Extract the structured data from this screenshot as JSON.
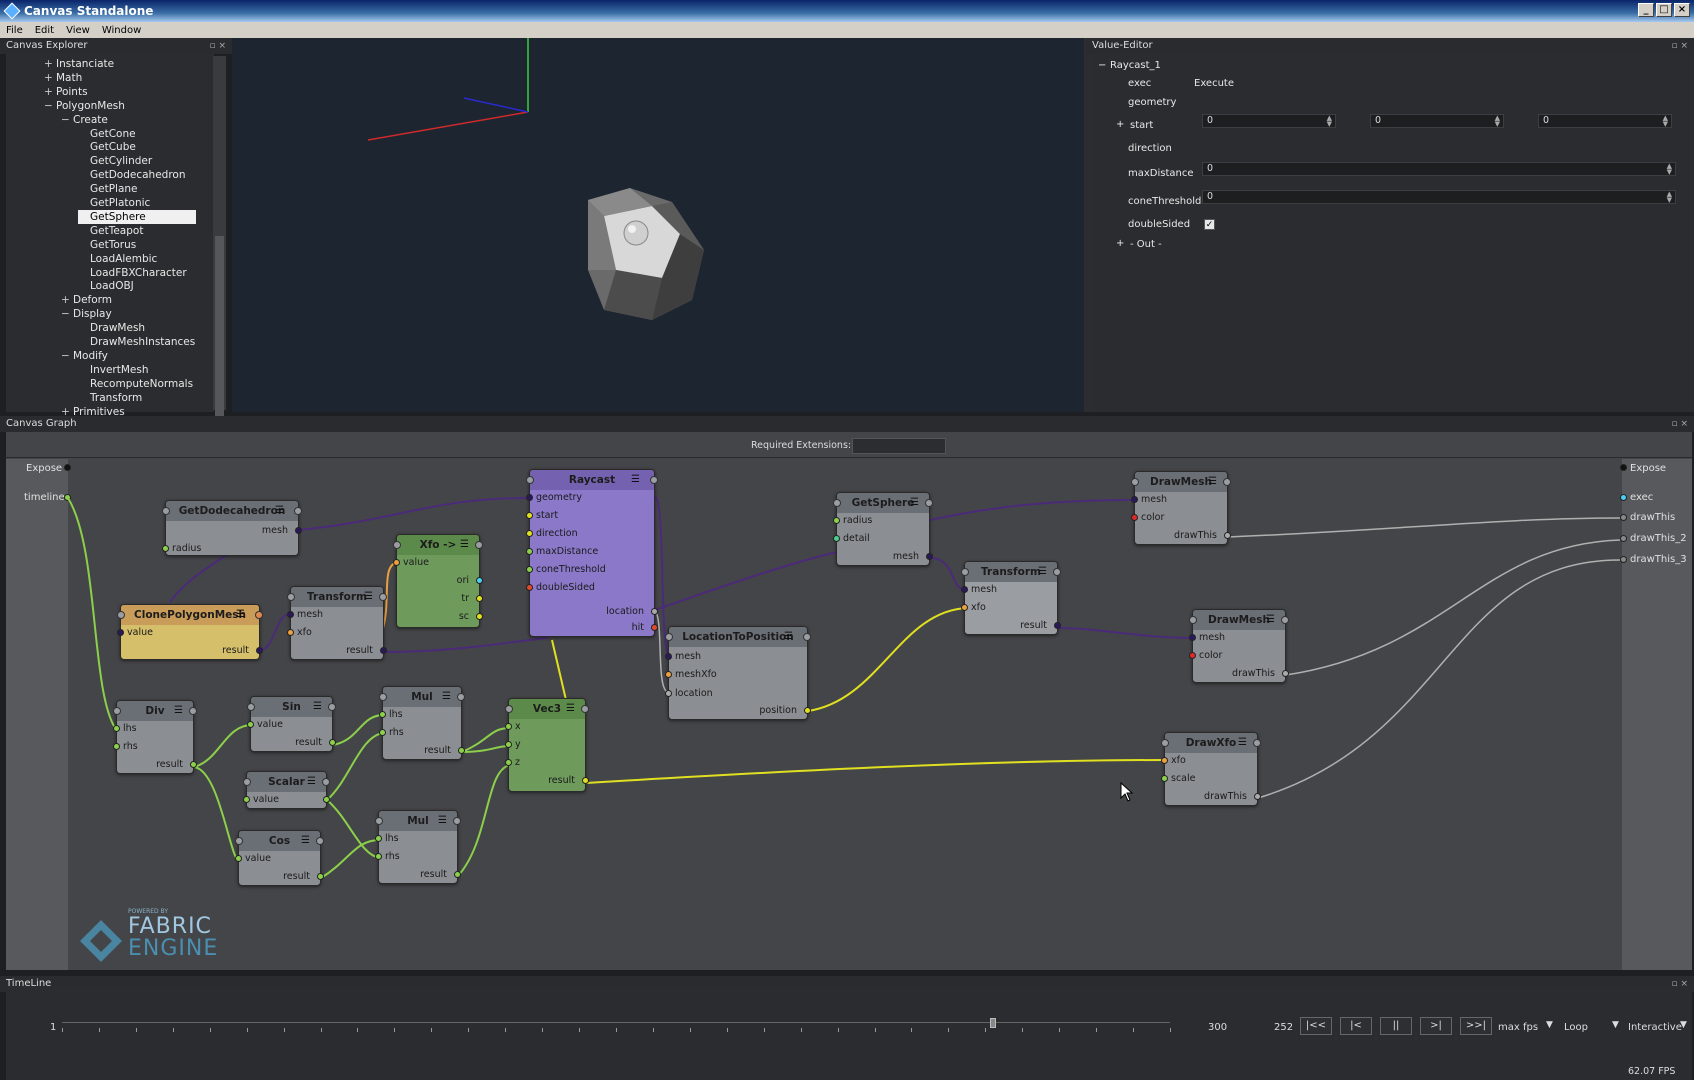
{
  "window": {
    "title": "Canvas Standalone"
  },
  "menu": [
    "File",
    "Edit",
    "View",
    "Window"
  ],
  "panels": {
    "explorer": "Canvas Explorer",
    "value_editor": "Value-Editor",
    "graph": "Canvas Graph",
    "timeline": "TimeLine"
  },
  "tree": [
    {
      "toggle": "+",
      "label": "Instanciate",
      "indent": 0
    },
    {
      "toggle": "+",
      "label": "Math",
      "indent": 0
    },
    {
      "toggle": "+",
      "label": "Points",
      "indent": 0
    },
    {
      "toggle": "−",
      "label": "PolygonMesh",
      "indent": 0
    },
    {
      "toggle": "−",
      "label": "Create",
      "indent": 1
    },
    {
      "toggle": "",
      "label": "GetCone",
      "indent": 2
    },
    {
      "toggle": "",
      "label": "GetCube",
      "indent": 2
    },
    {
      "toggle": "",
      "label": "GetCylinder",
      "indent": 2
    },
    {
      "toggle": "",
      "label": "GetDodecahedron",
      "indent": 2
    },
    {
      "toggle": "",
      "label": "GetPlane",
      "indent": 2
    },
    {
      "toggle": "",
      "label": "GetPlatonic",
      "indent": 2
    },
    {
      "toggle": "",
      "label": "GetSphere",
      "indent": 2,
      "selected": true
    },
    {
      "toggle": "",
      "label": "GetTeapot",
      "indent": 2
    },
    {
      "toggle": "",
      "label": "GetTorus",
      "indent": 2
    },
    {
      "toggle": "",
      "label": "LoadAlembic",
      "indent": 2
    },
    {
      "toggle": "",
      "label": "LoadFBXCharacter",
      "indent": 2
    },
    {
      "toggle": "",
      "label": "LoadOBJ",
      "indent": 2
    },
    {
      "toggle": "+",
      "label": "Deform",
      "indent": 1
    },
    {
      "toggle": "−",
      "label": "Display",
      "indent": 1
    },
    {
      "toggle": "",
      "label": "DrawMesh",
      "indent": 2
    },
    {
      "toggle": "",
      "label": "DrawMeshInstances",
      "indent": 2
    },
    {
      "toggle": "−",
      "label": "Modify",
      "indent": 1
    },
    {
      "toggle": "",
      "label": "InvertMesh",
      "indent": 2
    },
    {
      "toggle": "",
      "label": "RecomputeNormals",
      "indent": 2
    },
    {
      "toggle": "",
      "label": "Transform",
      "indent": 2
    },
    {
      "toggle": "+",
      "label": "Primitives",
      "indent": 1
    }
  ],
  "value_editor": {
    "node": "Raycast_1",
    "node_toggle": "−",
    "exec_label": "exec",
    "exec_value": "Execute",
    "geometry_label": "geometry",
    "start_toggle": "+",
    "start_label": "start",
    "start_values": [
      "0",
      "0",
      "0"
    ],
    "direction_label": "direction",
    "maxDistance_label": "maxDistance",
    "maxDistance_value": "0",
    "coneThreshold_label": "coneThreshold",
    "coneThreshold_value": "0",
    "doubleSided_label": "doubleSided",
    "doubleSided_checked": true,
    "out_toggle": "+",
    "out_label": "- Out -"
  },
  "graph": {
    "required_extensions_label": "Required Extensions:",
    "expose_left": "Expose",
    "timeline_port": "timeline",
    "expose_right": "Expose",
    "right_ports": [
      "exec",
      "drawThis",
      "drawThis_2",
      "drawThis_3"
    ],
    "nodes": [
      {
        "id": "GetDodecahedron",
        "title": "GetDodecahedron",
        "ports": [
          "mesh",
          "radius"
        ]
      },
      {
        "id": "ClonePolygonMesh",
        "title": "ClonePolygonMesh",
        "ports": [
          "value",
          "result"
        ]
      },
      {
        "id": "Transform1",
        "title": "Transform",
        "ports": [
          "mesh",
          "xfo",
          "result"
        ]
      },
      {
        "id": "Xfo",
        "title": "Xfo ->",
        "ports": [
          "value",
          "ori",
          "tr",
          "sc"
        ]
      },
      {
        "id": "Raycast",
        "title": "Raycast",
        "ports": [
          "geometry",
          "start",
          "direction",
          "maxDistance",
          "coneThreshold",
          "doubleSided",
          "location",
          "hit"
        ]
      },
      {
        "id": "LocationToPosition",
        "title": "LocationToPosition",
        "ports": [
          "mesh",
          "meshXfo",
          "location",
          "position"
        ]
      },
      {
        "id": "GetSphere",
        "title": "GetSphere",
        "ports": [
          "radius",
          "detail",
          "mesh"
        ]
      },
      {
        "id": "Transform2",
        "title": "Transform",
        "ports": [
          "mesh",
          "xfo",
          "result"
        ]
      },
      {
        "id": "DrawMesh1",
        "title": "DrawMesh",
        "ports": [
          "mesh",
          "color",
          "drawThis"
        ]
      },
      {
        "id": "DrawMesh2",
        "title": "DrawMesh",
        "ports": [
          "mesh",
          "color",
          "drawThis"
        ]
      },
      {
        "id": "DrawXfo",
        "title": "DrawXfo",
        "ports": [
          "xfo",
          "scale",
          "drawThis"
        ]
      },
      {
        "id": "Div",
        "title": "Div",
        "ports": [
          "lhs",
          "rhs",
          "result"
        ]
      },
      {
        "id": "Sin",
        "title": "Sin",
        "ports": [
          "value",
          "result"
        ]
      },
      {
        "id": "Mul1",
        "title": "Mul",
        "ports": [
          "lhs",
          "rhs",
          "result"
        ]
      },
      {
        "id": "Vec3",
        "title": "Vec3",
        "ports": [
          "x",
          "y",
          "z",
          "result"
        ]
      },
      {
        "id": "Scalar",
        "title": "Scalar",
        "ports": [
          "value"
        ]
      },
      {
        "id": "Cos",
        "title": "Cos",
        "ports": [
          "value",
          "result"
        ]
      },
      {
        "id": "Mul2",
        "title": "Mul",
        "ports": [
          "lhs",
          "rhs",
          "result"
        ]
      }
    ],
    "logo": {
      "small": "POWERED BY",
      "line1": "FABRIC",
      "line2": "ENGINE"
    }
  },
  "timeline": {
    "start": "1",
    "end": "300",
    "current": "252",
    "progress": 0.84,
    "buttons": [
      "|<<",
      "|<",
      "||",
      ">|",
      ">>|"
    ],
    "maxfps_label": "max fps",
    "loop_label": "Loop",
    "mode": "Interactive",
    "fps": "62.07 FPS"
  },
  "colors": {
    "raycast": "#8b78c8",
    "clone": "#d6bf6a",
    "green": "#6e9a5c",
    "wire_mesh": "#4b2a7a",
    "wire_yellow": "#e0e020",
    "wire_green": "#8ccf4a",
    "wire_grey": "#b0b0b0"
  }
}
